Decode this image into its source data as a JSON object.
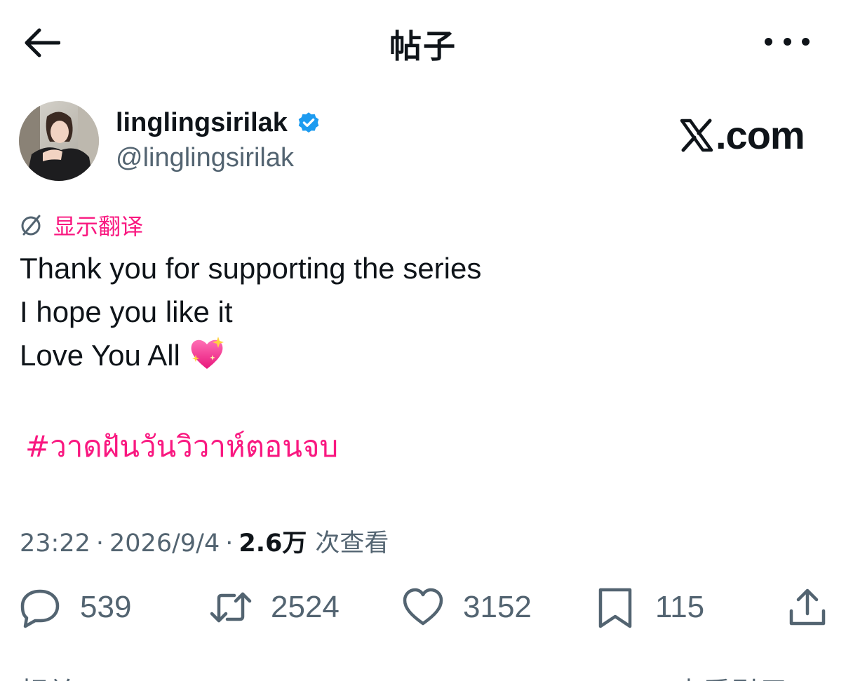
{
  "header": {
    "title": "帖子",
    "back_icon": "arrow-left-icon",
    "more_icon": "more-horizontal-icon"
  },
  "author": {
    "display_name": "linglingsirilak",
    "handle": "@linglingsirilak",
    "verified": true,
    "verified_color": "#1d9bf0"
  },
  "brand": {
    "text": ".com",
    "logo_letter": "X"
  },
  "translate": {
    "label": "显示翻译",
    "icon": "translate-globe-icon",
    "color": "#f91880"
  },
  "post": {
    "lines": [
      "Thank you for supporting the series",
      "I hope you like it",
      "Love You All"
    ],
    "emoji": "sparkling-heart-icon",
    "hashtag": "#วาดฝันวันวิวาห์ตอนจบ"
  },
  "meta": {
    "time": "23:22",
    "date": "2026/9/4",
    "separator": "·",
    "views_count": "2.6万",
    "views_label": "次查看"
  },
  "actions": {
    "replies": "539",
    "reposts": "2524",
    "likes": "3152",
    "bookmarks": "115"
  },
  "bottom": {
    "left_label": "相关",
    "right_label": "查看引用 ›"
  },
  "colors": {
    "text": "#0f1419",
    "secondary": "#536471",
    "accent_pink": "#f91880",
    "verified_blue": "#1d9bf0"
  }
}
